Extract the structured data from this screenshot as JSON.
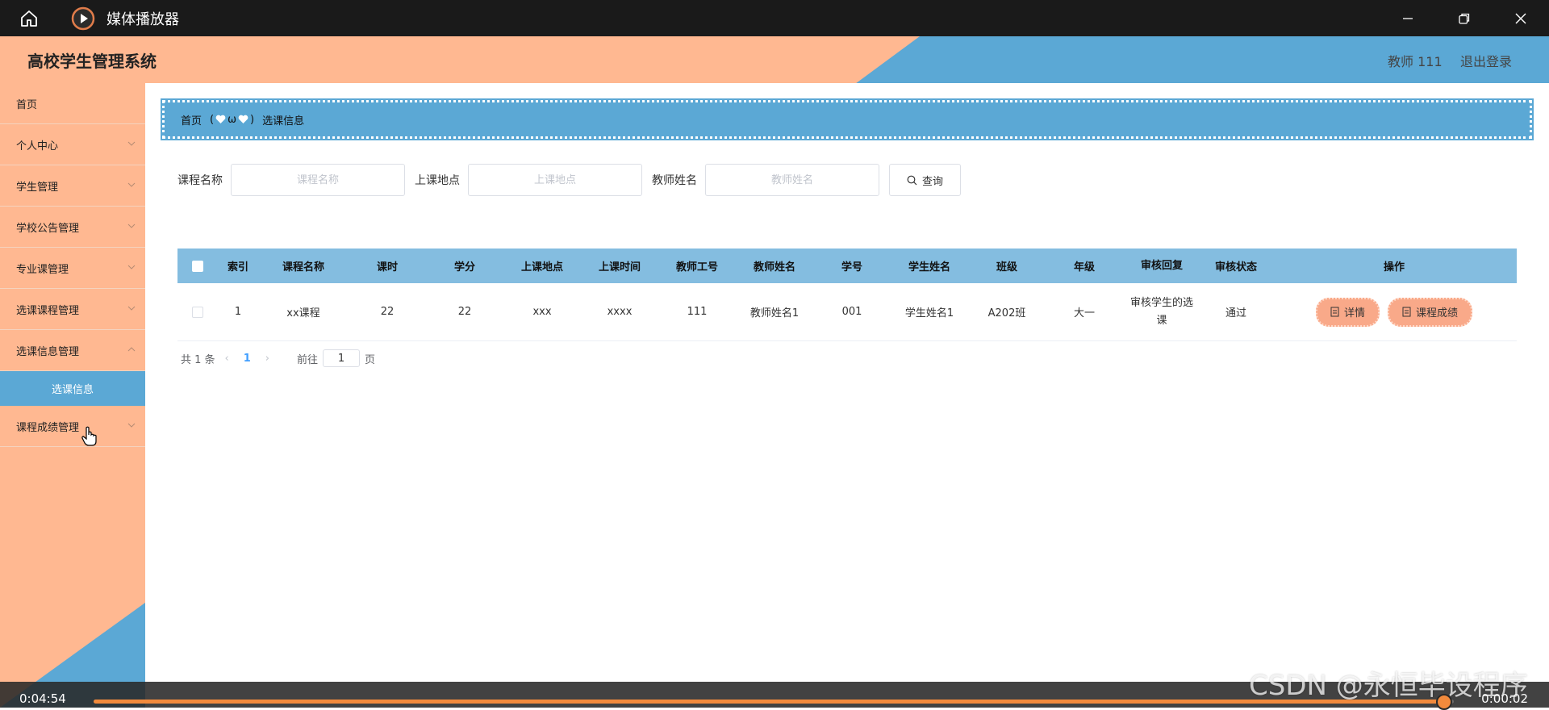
{
  "player_window": {
    "title": "媒体播放器",
    "controls": [
      "minimize-icon",
      "restore-icon",
      "close-icon"
    ],
    "elapsed": "0:04:54",
    "remaining": "0:00:02",
    "progress_fraction": 0.993,
    "accent": "#f28a3c"
  },
  "header": {
    "brand": "高校学生管理系统",
    "user": "教师 111",
    "logout": "退出登录",
    "colors": {
      "peach": "#ffb891",
      "blue": "#5ba8d5"
    }
  },
  "sidebar": {
    "items": [
      {
        "label": "首页",
        "has_children": false
      },
      {
        "label": "个人中心",
        "has_children": true
      },
      {
        "label": "学生管理",
        "has_children": true
      },
      {
        "label": "学校公告管理",
        "has_children": true
      },
      {
        "label": "专业课管理",
        "has_children": true
      },
      {
        "label": "选课课程管理",
        "has_children": true
      },
      {
        "label": "选课信息管理",
        "has_children": true,
        "expanded": true,
        "children": [
          "选课信息"
        ]
      },
      {
        "label": "课程成绩管理",
        "has_children": true
      }
    ]
  },
  "breadcrumb": {
    "home": "首页",
    "separator": "ω",
    "current": "选课信息"
  },
  "search": {
    "course_label": "课程名称",
    "course_placeholder": "课程名称",
    "place_label": "上课地点",
    "place_placeholder": "上课地点",
    "teacher_label": "教师姓名",
    "teacher_placeholder": "教师姓名",
    "button": "查询"
  },
  "table": {
    "headers": [
      "索引",
      "课程名称",
      "课时",
      "学分",
      "上课地点",
      "上课时间",
      "教师工号",
      "教师姓名",
      "学号",
      "学生姓名",
      "班级",
      "年级",
      "审核回复",
      "审核状态",
      "操作"
    ],
    "rows": [
      {
        "index": "1",
        "course": "xx课程",
        "hours": "22",
        "credit": "22",
        "place": "xxx",
        "time": "xxxx",
        "teacher_no": "111",
        "teacher_name": "教师姓名1",
        "student_no": "001",
        "student_name": "学生姓名1",
        "class": "A202班",
        "grade": "大一",
        "reply": "审核学生的选课",
        "status": "通过",
        "actions": [
          "详情",
          "课程成绩"
        ]
      }
    ]
  },
  "pagination": {
    "total": "共 1 条",
    "current": "1",
    "goto_prefix": "前往",
    "goto_value": "1",
    "goto_suffix": "页"
  },
  "watermark": "CSDN @永恒毕设程序"
}
